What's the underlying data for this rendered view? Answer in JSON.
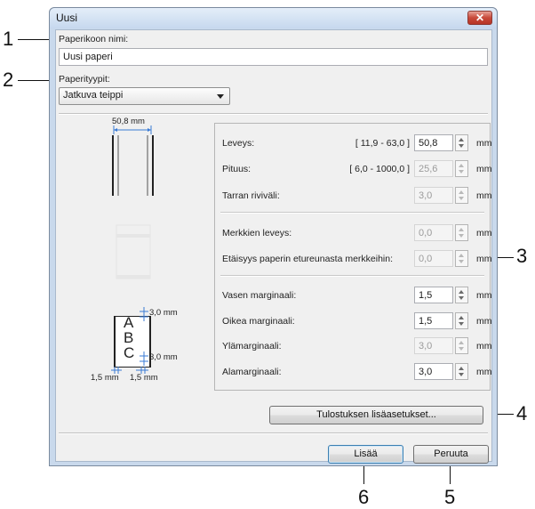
{
  "window": {
    "title": "Uusi",
    "close_symbol": "✕"
  },
  "paper_name": {
    "label": "Paperikoon nimi:",
    "value": "Uusi paperi"
  },
  "paper_type": {
    "label": "Paperityypit:",
    "selected": "Jatkuva teippi"
  },
  "preview": {
    "width_label": "50,8 mm",
    "abc": [
      "A",
      "B",
      "C"
    ],
    "top_margin_label": "3,0 mm",
    "bottom_margin_label": "3,0 mm",
    "left_margin_label": "1,5 mm",
    "right_margin_label": "1,5 mm"
  },
  "params": [
    {
      "label": "Leveys:",
      "range": "[ 11,9 - 63,0 ]",
      "value": "50,8",
      "unit": "mm",
      "enabled": true
    },
    {
      "label": "Pituus:",
      "range": "[ 6,0 - 1000,0 ]",
      "value": "25,6",
      "unit": "mm",
      "enabled": false
    },
    {
      "label": "Tarran riviväli:",
      "range": "",
      "value": "3,0",
      "unit": "mm",
      "enabled": false
    },
    {
      "label": "Merkkien leveys:",
      "range": "",
      "value": "0,0",
      "unit": "mm",
      "enabled": false
    },
    {
      "label": "Etäisyys paperin etureunasta merkkeihin:",
      "range": "",
      "value": "0,0",
      "unit": "mm",
      "enabled": false
    },
    {
      "label": "Vasen marginaali:",
      "range": "",
      "value": "1,5",
      "unit": "mm",
      "enabled": true
    },
    {
      "label": "Oikea marginaali:",
      "range": "",
      "value": "1,5",
      "unit": "mm",
      "enabled": true
    },
    {
      "label": "Ylämarginaali:",
      "range": "",
      "value": "3,0",
      "unit": "mm",
      "enabled": false
    },
    {
      "label": "Alamarginaali:",
      "range": "",
      "value": "3,0",
      "unit": "mm",
      "enabled": true
    }
  ],
  "buttons": {
    "advanced": "Tulostuksen lisäasetukset...",
    "add": "Lisää",
    "cancel": "Peruuta"
  },
  "callouts": [
    "1",
    "2",
    "3",
    "4",
    "5",
    "6"
  ]
}
